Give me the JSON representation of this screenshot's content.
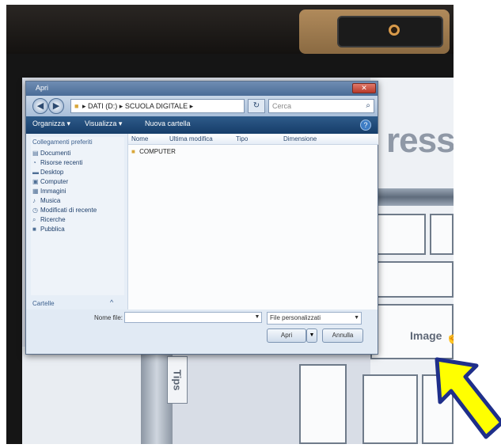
{
  "bezel": {
    "led_icon": "power-ring-icon"
  },
  "dialog": {
    "title": "Apri",
    "close_icon": "close-icon",
    "address": {
      "path": "▸ DATI (D:) ▸ SCUOLA DIGITALE ▸",
      "refresh_icon": "refresh-icon",
      "search_placeholder": "Cerca",
      "search_icon": "search-icon"
    },
    "toolbar": {
      "organize": "Organizza ▾",
      "views": "Visualizza ▾",
      "new_folder": "Nuova cartella"
    },
    "nav": {
      "heading": "Collegamenti preferiti",
      "items": [
        {
          "label": "Documenti",
          "icon": "documents-icon"
        },
        {
          "label": "Risorse recenti",
          "icon": "recent-icon"
        },
        {
          "label": "Desktop",
          "icon": "desktop-icon"
        },
        {
          "label": "Computer",
          "icon": "computer-icon"
        },
        {
          "label": "Immagini",
          "icon": "pictures-icon"
        },
        {
          "label": "Musica",
          "icon": "music-icon"
        },
        {
          "label": "Modificati di recente",
          "icon": "recently-changed-icon"
        },
        {
          "label": "Ricerche",
          "icon": "searches-icon"
        },
        {
          "label": "Pubblica",
          "icon": "public-icon"
        }
      ],
      "folders_label": "Cartelle",
      "folders_chevron": "^"
    },
    "columns": [
      "Nome",
      "Ultima modifica",
      "Tipo",
      "Dimensione"
    ],
    "files": [
      {
        "name": "COMPUTER",
        "icon": "folder-icon"
      }
    ],
    "bottom": {
      "filename_label": "Nome file:",
      "filename_value": "",
      "filter_value": "File personalizzati",
      "open_label": "Apri",
      "cancel_label": "Annulla"
    }
  },
  "background_page": {
    "press_text": "ress",
    "tips_text": "Tips",
    "image_text": "Image",
    "pointer_icon": "hand-pointer-icon"
  },
  "annotation": {
    "arrow_color": "#ffff00",
    "arrow_outline": "#1f2f8a",
    "arrow_icon": "yellow-arrow-icon"
  }
}
